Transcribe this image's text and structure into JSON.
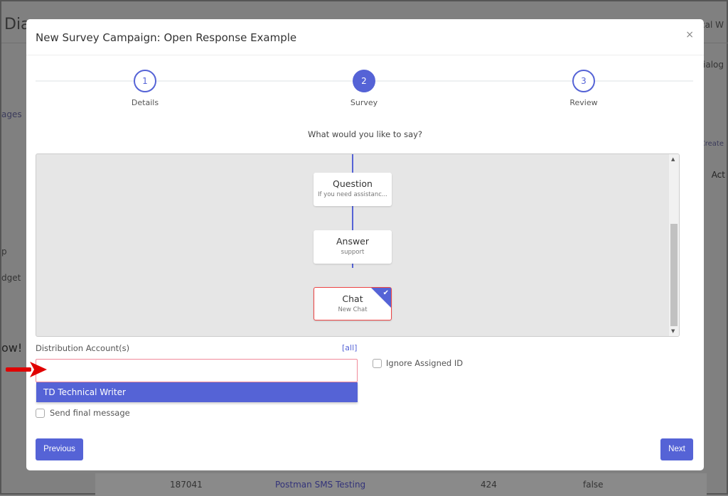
{
  "background": {
    "title": "Dia",
    "user": "ical W",
    "link_left": "ages",
    "left_text_1": "p",
    "left_text_2": "dget",
    "left_text_3": "ow!",
    "right_text_1": "Dialog",
    "right_text_2": "Create",
    "right_text_3": "Act",
    "row": {
      "id": "187041",
      "name": "Postman SMS Testing",
      "count": "424",
      "flag": "false"
    }
  },
  "modal": {
    "title": "New Survey Campaign: Open Response Example",
    "close": "×",
    "steps": [
      {
        "number": "1",
        "label": "Details"
      },
      {
        "number": "2",
        "label": "Survey",
        "active": true
      },
      {
        "number": "3",
        "label": "Review"
      }
    ],
    "prompt": "What would you like to say?",
    "flow": [
      {
        "title": "Question",
        "subtitle": "If you need assistanc..."
      },
      {
        "title": "Answer",
        "subtitle": "support"
      },
      {
        "title": "Chat",
        "subtitle": "New Chat",
        "selected": true
      }
    ],
    "distribution": {
      "label": "Distribution Account(s)",
      "all_link": "[all]",
      "value": "",
      "options": [
        "TD Technical Writer"
      ]
    },
    "ignore_assigned_id": {
      "label": "Ignore Assigned ID",
      "checked": false
    },
    "send_final_message": {
      "label": "Send final message",
      "checked": false
    },
    "previous_label": "Previous",
    "next_label": "Next"
  },
  "colors": {
    "accent": "#5563d6",
    "error_border": "#f18a9a",
    "annotation_arrow": "#e00000"
  }
}
